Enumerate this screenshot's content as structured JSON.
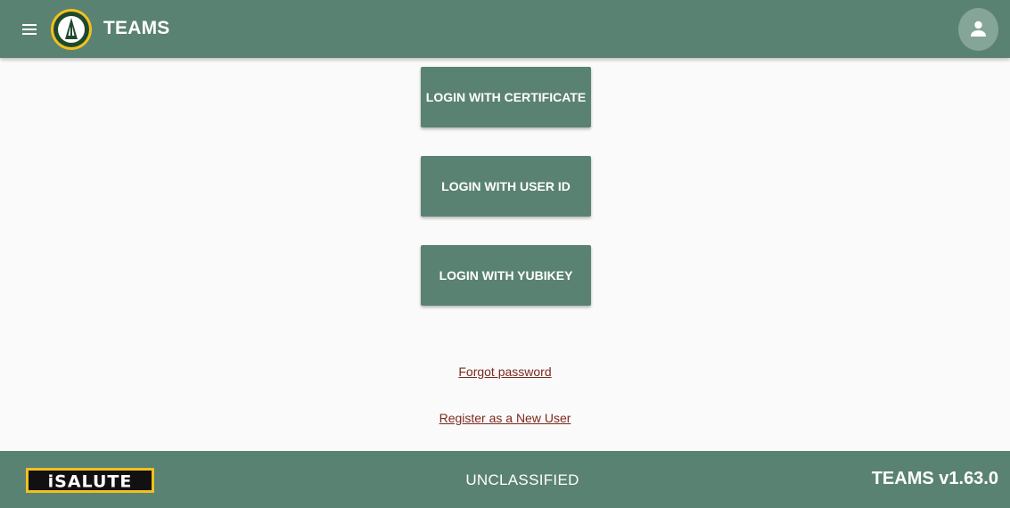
{
  "header": {
    "title": "TEAMS",
    "menu_icon": "hamburger-menu-icon",
    "logo_icon": "unit-emblem-logo",
    "account_icon": "person-icon"
  },
  "login": {
    "certificate_label": "LOGIN WITH CERTIFICATE",
    "user_id_label": "LOGIN WITH USER ID",
    "yubikey_label": "LOGIN WITH YUBIKEY"
  },
  "links": {
    "forgot_password": "Forgot password",
    "register": "Register as a New User"
  },
  "footer": {
    "logo_text": "iSALUTE",
    "classification": "UNCLASSIFIED",
    "version": "TEAMS v1.63.0"
  },
  "colors": {
    "primary": "#5a8272",
    "background": "#fafafa",
    "link": "#7a2a1f",
    "logo_gold": "#f2c01e"
  }
}
